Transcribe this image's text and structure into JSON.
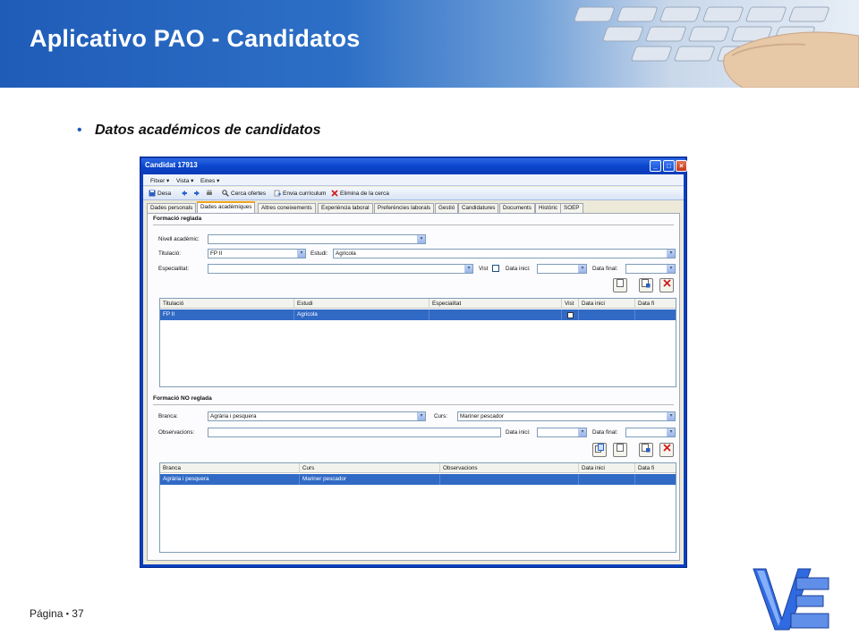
{
  "slide": {
    "title": "Aplicativo PAO - Candidatos",
    "bullet": "Datos académicos de candidatos",
    "footer_label": "Página",
    "footer_sep": "▪",
    "page_number": "37"
  },
  "window": {
    "title": "Candidat 17913",
    "menu": [
      "Fitxer ▾",
      "Vista ▾",
      "Eines ▾"
    ],
    "toolbar": {
      "save": "Desa",
      "search_offers": "Cerca ofertes",
      "send_cv": "Envia currículum",
      "delete_search": "Elimina de la cerca"
    },
    "tabs": [
      "Dades personals",
      "Dades acadèmiques",
      "Altres coneixements",
      "Experiència laboral",
      "Preferències laborals",
      "Gestió",
      "Candidatures",
      "Documents",
      "Històric",
      "SOEP"
    ],
    "active_tab": "Dades acadèmiques"
  },
  "formal": {
    "title": "Formació reglada",
    "labels": {
      "level": "Nivell acadèmic:",
      "titulacio": "Titulació:",
      "estudi": "Estudi:",
      "especialitat": "Especialitat:",
      "vist": "Vist",
      "data_inici": "Data inici:",
      "data_final": "Data final:"
    },
    "values": {
      "level": "",
      "titulacio": "FP II",
      "estudi": "Agricola",
      "especialitat": ""
    },
    "grid_headers": [
      "Titulació",
      "Estudi",
      "Especialitat",
      "Vist",
      "Data inici",
      "Data fi"
    ],
    "grid_rows": [
      {
        "titulacio": "FP II",
        "estudi": "Agricola",
        "especialitat": "",
        "data_inici": "",
        "data_fi": ""
      }
    ]
  },
  "nonformal": {
    "title": "Formació NO reglada",
    "labels": {
      "branca": "Branca:",
      "curs": "Curs:",
      "observacions": "Observacions:",
      "data_inici": "Data inici:",
      "data_final": "Data final:"
    },
    "values": {
      "branca": "Agrària i pesquera",
      "curs": "Mariner pescador",
      "observacions": ""
    },
    "grid_headers": [
      "Branca",
      "Curs",
      "Observacions",
      "Data inici",
      "Data fi"
    ],
    "grid_rows": [
      {
        "branca": "Agrària i pesquera",
        "curs": "Mariner pescador",
        "observacions": "",
        "data_inici": "",
        "data_fi": ""
      }
    ]
  },
  "colors": {
    "header_blue": "#1f5cb8",
    "selection": "#316ac5",
    "xp_title": "#0b47cf"
  }
}
